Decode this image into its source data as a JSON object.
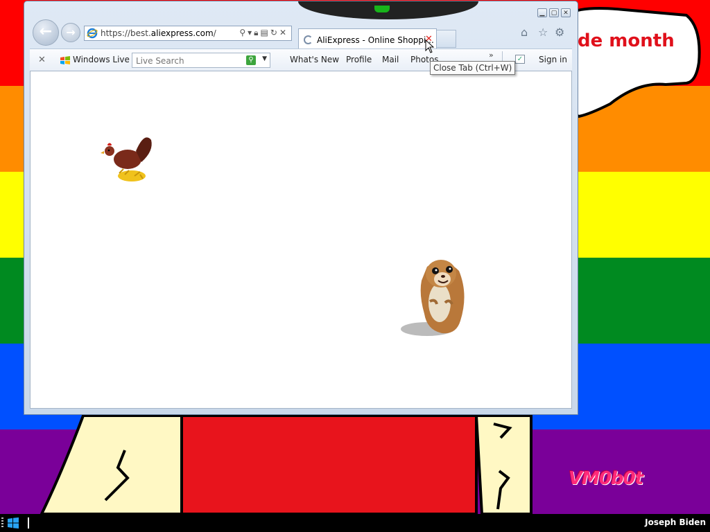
{
  "desktop": {
    "stripe_colors": [
      "#ff0000",
      "#ff8c00",
      "#ffff00",
      "#008a20",
      "#0050ff",
      "#7a0099"
    ],
    "speech_bubble_text": "de month",
    "watermark": "VM0b0t"
  },
  "browser": {
    "address": {
      "url_prefix": "https://best.",
      "url_domain": "aliexpress.com",
      "url_suffix": "/"
    },
    "tab": {
      "title": "AliExpress - Online Shoppi...",
      "close_tooltip": "Close Tab (Ctrl+W)"
    },
    "toolbar": {
      "windows_live_label": "Windows Live",
      "search_placeholder": "Live Search",
      "links": [
        "What's New",
        "Profile",
        "Mail",
        "Photos"
      ],
      "overflow_label": "»",
      "sign_in_label": "Sign in"
    },
    "icons": [
      "back-arrow-icon",
      "forward-arrow-icon",
      "ie-logo-icon",
      "home-icon",
      "star-icon",
      "gear-icon",
      "lock-icon",
      "refresh-icon",
      "stop-icon"
    ]
  },
  "taskbar": {
    "user_name": "Joseph Biden"
  }
}
